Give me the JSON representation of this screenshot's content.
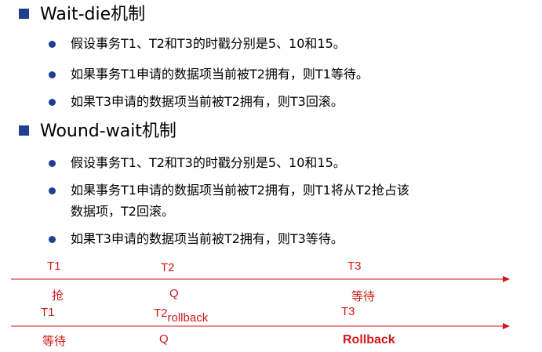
{
  "sections": [
    {
      "title": "Wait-die机制",
      "items": [
        "假设事务T1、T2和T3的时戳分别是5、10和15。",
        "如果事务T1申请的数据项当前被T2拥有，则T1等待。",
        "如果T3申请的数据项当前被T2拥有，则T3回滚。"
      ]
    },
    {
      "title": "Wound-wait机制",
      "items": [
        "假设事务T1、T2和T3的时戳分别是5、10和15。",
        "如果事务T1申请的数据项当前被T2拥有，则T1将从T2抢占该",
        "如果T3申请的数据项当前被T2拥有，则T3等待。"
      ],
      "continuation": "数据项，T2回滚。"
    }
  ],
  "timeline1": {
    "t1": "T1",
    "t2": "T2",
    "t3": "T3",
    "under1": "抢",
    "under2": "Q",
    "under3": "等待"
  },
  "timeline2": {
    "t1": "T1",
    "t2": "T2",
    "t2_suffix": "rollback",
    "t3": "T3",
    "under1": "等待",
    "under2": "Q",
    "under3": "Rollback"
  },
  "colors": {
    "bullet": "#1f3f8f",
    "annotation": "#d01818"
  }
}
